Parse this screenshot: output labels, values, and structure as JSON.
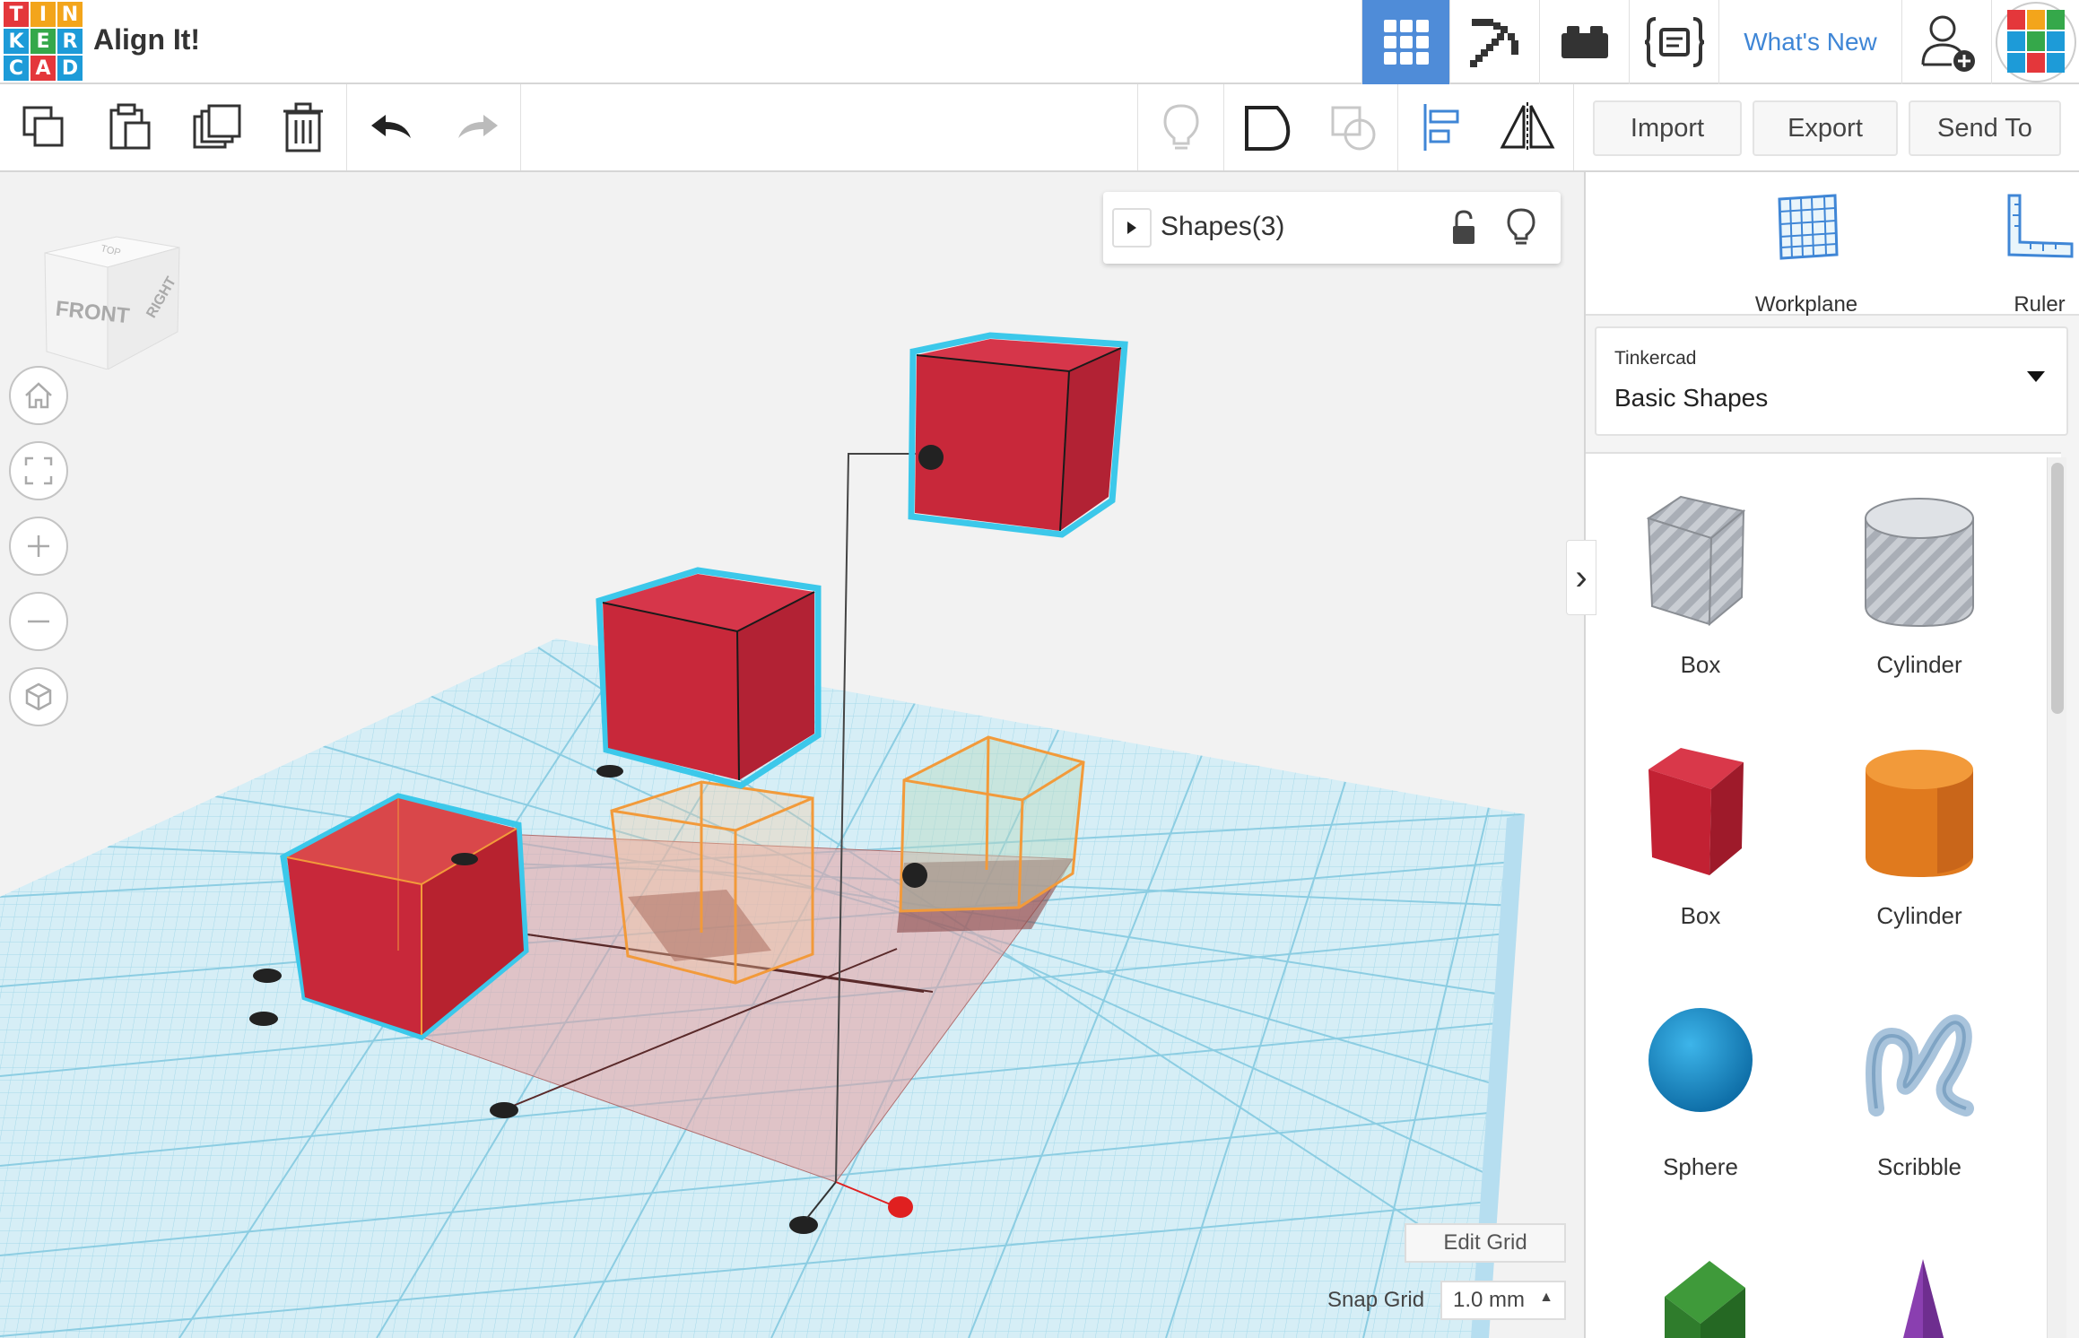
{
  "app": {
    "title": "Align It!",
    "logo_letters": [
      "T",
      "I",
      "N",
      "K",
      "E",
      "R",
      "C",
      "A",
      "D"
    ],
    "logo_colors": [
      "#e4373b",
      "#f3a51b",
      "#f3a51b",
      "#1d9bd8",
      "#35a84a",
      "#1d9bd8",
      "#1d9bd8",
      "#e4373b",
      "#1d9bd8"
    ]
  },
  "header": {
    "whats_new": "What's New",
    "active_view": "3d-design",
    "accent_color": "#4f8cd8"
  },
  "toolbar": {
    "import_label": "Import",
    "export_label": "Export",
    "send_to_label": "Send To"
  },
  "shapes_panel": {
    "title": "Shapes(3)"
  },
  "view_cube": {
    "front": "FRONT",
    "right": "RIGHT",
    "top": "TOP"
  },
  "grid_controls": {
    "edit_grid": "Edit Grid",
    "snap_grid_label": "Snap Grid",
    "snap_grid_value": "1.0 mm"
  },
  "right_panel": {
    "workplane_label": "Workplane",
    "ruler_label": "Ruler",
    "library_category": "Tinkercad",
    "library_name": "Basic Shapes",
    "shapes": [
      {
        "label": "Box",
        "icon": "box-hole-icon"
      },
      {
        "label": "Cylinder",
        "icon": "cylinder-hole-icon"
      },
      {
        "label": "Box",
        "icon": "box-icon"
      },
      {
        "label": "Cylinder",
        "icon": "cylinder-icon"
      },
      {
        "label": "Sphere",
        "icon": "sphere-icon"
      },
      {
        "label": "Scribble",
        "icon": "scribble-icon"
      }
    ]
  },
  "colors": {
    "shape_red": "#c8283a",
    "selection_outline": "#3cc8ea",
    "grid_blue": "#bfe6f2",
    "ghost_orange": "#f29a3a"
  }
}
